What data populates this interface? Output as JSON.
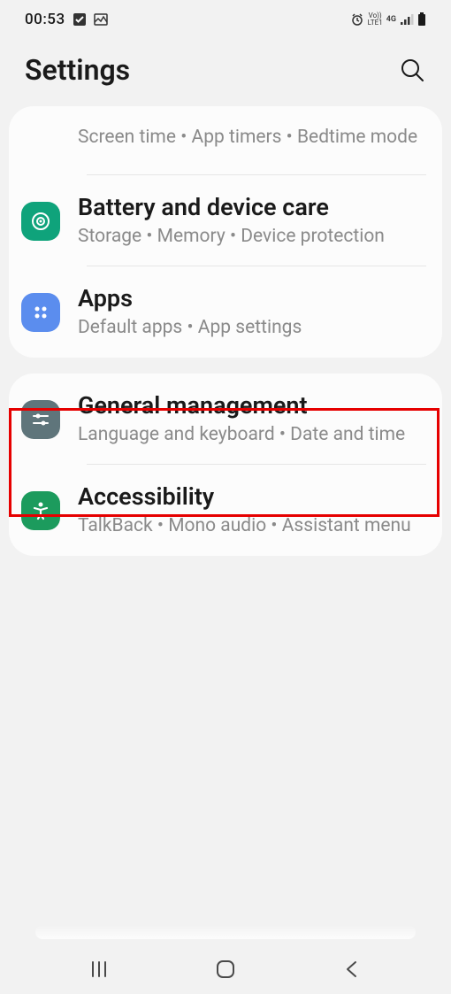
{
  "status": {
    "time": "00:53",
    "network": "4G",
    "carrier": "LTE1",
    "volte": "Vo))"
  },
  "header": {
    "title": "Settings"
  },
  "cards": [
    {
      "items": [
        {
          "title": "",
          "subtitle": "Screen time  •  App timers  •  Bedtime mode",
          "icon": "spacer",
          "highlighted": false
        },
        {
          "title": "Battery and device care",
          "subtitle": "Storage  •  Memory  •  Device protection",
          "icon": "device-care",
          "highlighted": false
        },
        {
          "title": "Apps",
          "subtitle": "Default apps  •  App settings",
          "icon": "apps",
          "highlighted": true
        }
      ]
    },
    {
      "items": [
        {
          "title": "General management",
          "subtitle": "Language and keyboard  •  Date and time",
          "icon": "general",
          "highlighted": false
        },
        {
          "title": "Accessibility",
          "subtitle": "TalkBack  •  Mono audio  •  Assistant menu",
          "icon": "accessibility",
          "highlighted": false
        }
      ]
    }
  ]
}
